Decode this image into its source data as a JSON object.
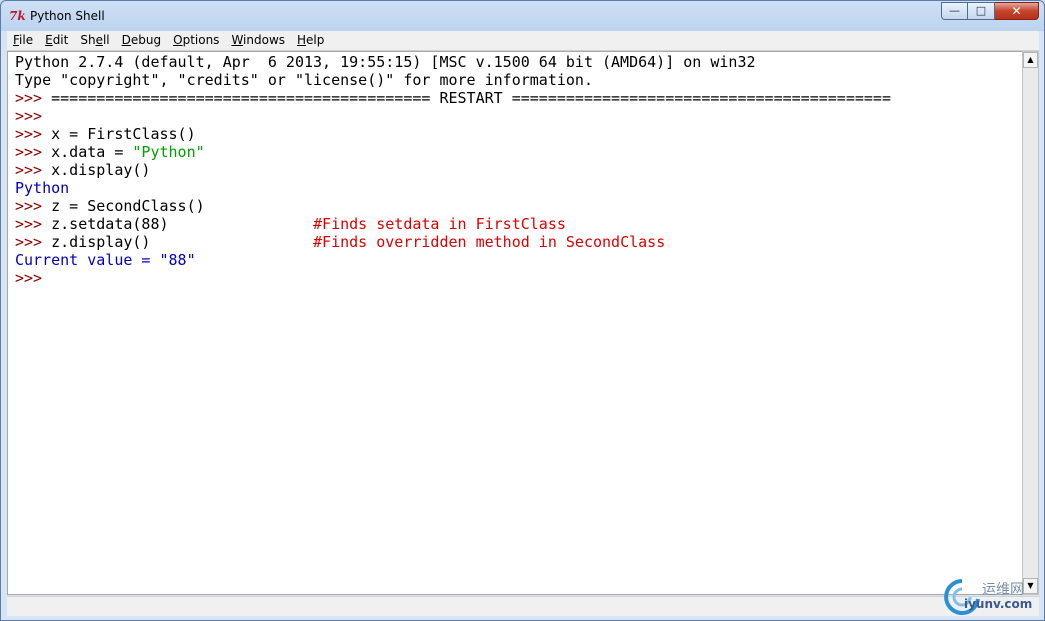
{
  "window": {
    "title": "Python Shell",
    "icon_text": "7k"
  },
  "menu": [
    {
      "underline": "F",
      "rest": "ile"
    },
    {
      "underline": "E",
      "rest": "dit"
    },
    {
      "underline": "",
      "rest": "Shell",
      "u_index": 3
    },
    {
      "underline": "D",
      "rest": "ebug"
    },
    {
      "underline": "O",
      "rest": "ptions"
    },
    {
      "underline": "W",
      "rest": "indows"
    },
    {
      "underline": "H",
      "rest": "elp"
    }
  ],
  "shell": {
    "banner1": "Python 2.7.4 (default, Apr  6 2013, 19:55:15) [MSC v.1500 64 bit (AMD64)] on win32",
    "banner2": "Type \"copyright\", \"credits\" or \"license()\" for more information.",
    "prompt": ">>> ",
    "prompt_bare": ">>>",
    "restart": "========================================== RESTART ==========================================",
    "cmd1": "x = FirstClass()",
    "cmd2_code": "x.data = ",
    "cmd2_str": "\"Python\"",
    "cmd3": "x.display()",
    "out1": "Python",
    "cmd4": "z = SecondClass()",
    "cmd5_code": "z.setdata(88)                ",
    "cmd5_comment": "#Finds setdata in FirstClass",
    "cmd6_code": "z.display()                  ",
    "cmd6_comment": "#Finds overridden method in SecondClass",
    "out2": "Current value = \"88\""
  },
  "watermark": {
    "line1": "运维网",
    "line2": "iyunv.com"
  }
}
